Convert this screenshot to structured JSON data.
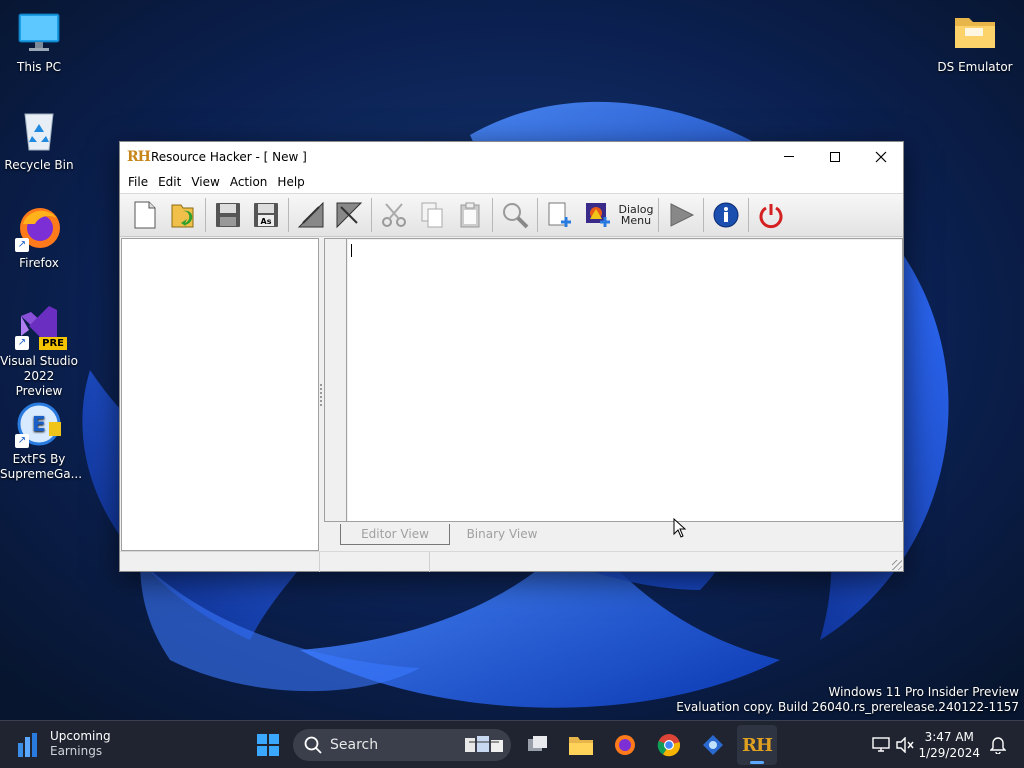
{
  "desktop": {
    "icons": [
      {
        "label": "This PC"
      },
      {
        "label": "Recycle Bin"
      },
      {
        "label": "Firefox"
      },
      {
        "label": "Visual Studio 2022 Preview",
        "badge": "PRE"
      },
      {
        "label": "ExtFS By SupremeGa..."
      },
      {
        "label": "DS Emulator"
      }
    ]
  },
  "window": {
    "logo": "RH",
    "title": "Resource Hacker - [ New ]",
    "menu": [
      "File",
      "Edit",
      "View",
      "Action",
      "Help"
    ],
    "toolbar": {
      "dialog_menu_label_line1": "Dialog",
      "dialog_menu_label_line2": "Menu"
    },
    "tabs": [
      "Editor View",
      "Binary View"
    ]
  },
  "watermark": {
    "line1": "Windows 11 Pro Insider Preview",
    "line2": "Evaluation copy. Build 26040.rs_prerelease.240122-1157"
  },
  "taskbar": {
    "weather_title": "Upcoming",
    "weather_subtitle": "Earnings",
    "search_placeholder": "Search",
    "rh_label": "RH",
    "time": "3:47 AM",
    "date": "1/29/2024"
  },
  "colors": {
    "wallpaper_base": "#0a1a3a",
    "bloom_blue": "#1e5cf0",
    "taskbar": "#1f2430",
    "rh_gold": "#c8861a"
  }
}
